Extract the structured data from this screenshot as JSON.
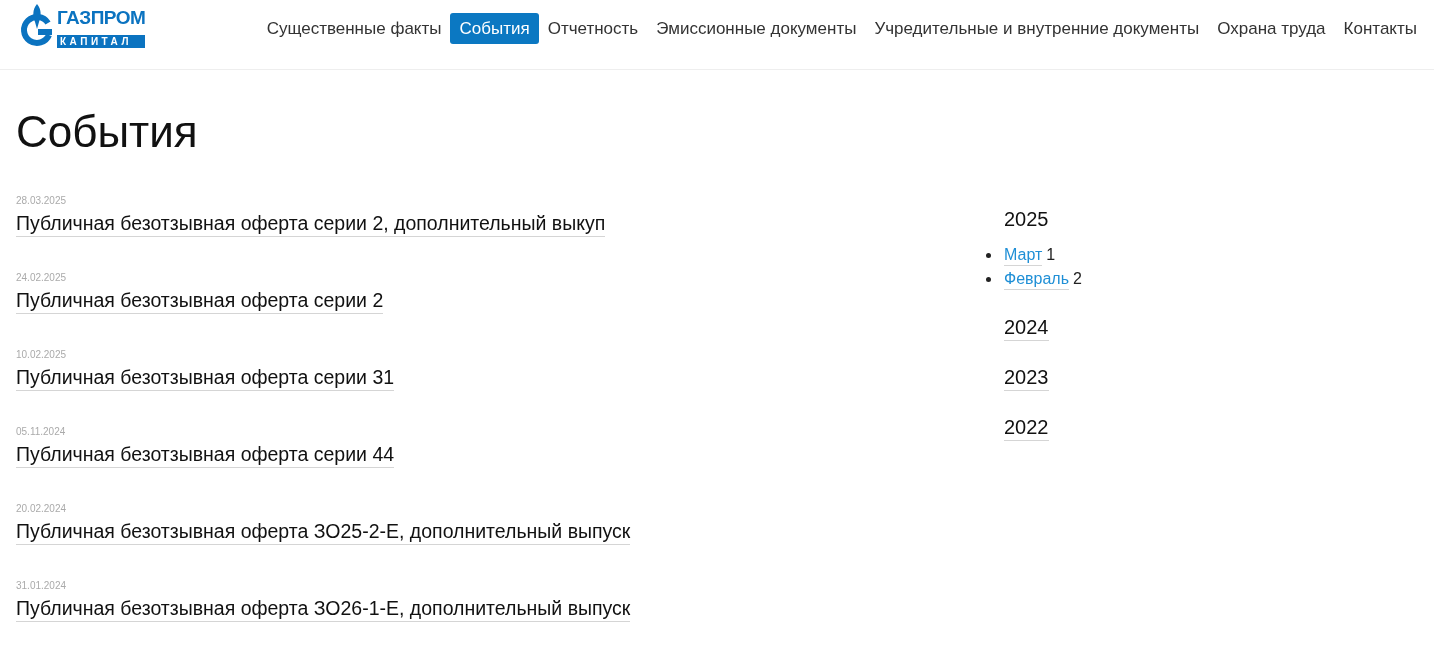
{
  "header": {
    "logo": {
      "name": "ГАЗПРОМ",
      "subtitle": "КАПИТАЛ"
    },
    "nav": [
      {
        "label": "Существенные факты",
        "selected": false
      },
      {
        "label": "События",
        "selected": true
      },
      {
        "label": "Отчетность",
        "selected": false
      },
      {
        "label": "Эмиссионные документы",
        "selected": false
      },
      {
        "label": "Учредительные и внутренние документы",
        "selected": false
      },
      {
        "label": "Охрана труда",
        "selected": false
      },
      {
        "label": "Контакты",
        "selected": false
      }
    ]
  },
  "page": {
    "title": "События"
  },
  "events": [
    {
      "date": "28.03.2025",
      "title": "Публичная безотзывная оферта серии 2, дополнительный выкуп"
    },
    {
      "date": "24.02.2025",
      "title": "Публичная безотзывная оферта серии 2"
    },
    {
      "date": "10.02.2025",
      "title": "Публичная безотзывная оферта серии 31"
    },
    {
      "date": "05.11.2024",
      "title": "Публичная безотзывная оферта серии 44"
    },
    {
      "date": "20.02.2024",
      "title": "Публичная безотзывная оферта ЗО25-2-Е, дополнительный выпуск"
    },
    {
      "date": "31.01.2024",
      "title": "Публичная безотзывная оферта ЗО26-1-Е, дополнительный выпуск"
    }
  ],
  "archive": [
    {
      "year": "2025",
      "expanded": true,
      "months": [
        {
          "name": "Март",
          "count": "1"
        },
        {
          "name": "Февраль",
          "count": "2"
        }
      ]
    },
    {
      "year": "2024",
      "expanded": false
    },
    {
      "year": "2023",
      "expanded": false
    },
    {
      "year": "2022",
      "expanded": false
    }
  ]
}
